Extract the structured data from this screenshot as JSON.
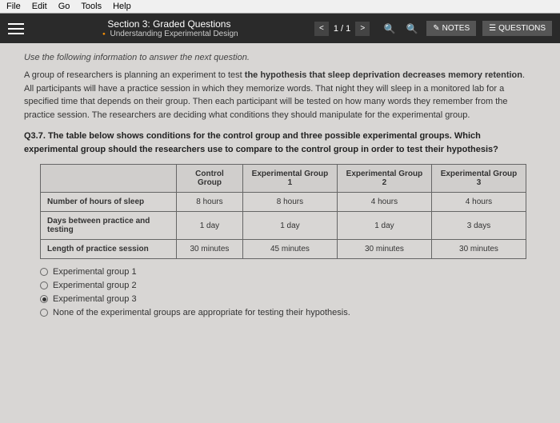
{
  "menu": {
    "file": "File",
    "edit": "Edit",
    "go": "Go",
    "tools": "Tools",
    "help": "Help"
  },
  "header": {
    "section": "Section 3: Graded Questions",
    "subtitle": "Understanding Experimental Design",
    "page": "1 / 1",
    "notes": "NOTES",
    "questions": "QUESTIONS"
  },
  "instruction": "Use the following information to answer the next question.",
  "paragraph_pre": "A group of researchers is planning an experiment to test ",
  "paragraph_bold": "the hypothesis that sleep deprivation decreases memory retention",
  "paragraph_post": ". All participants will have a practice session in which they memorize words. That night they will sleep in a monitored lab for a specified time that depends on their group. Then each participant will be tested on how many words they remember from the practice session. The researchers are deciding what conditions they should manipulate for the experimental group.",
  "question": "Q3.7. The table below shows conditions for the control group and three possible experimental groups. Which experimental group should the researchers use to compare to the control group in order to test their hypothesis?",
  "table": {
    "headers": [
      "",
      "Control Group",
      "Experimental Group 1",
      "Experimental Group 2",
      "Experimental Group 3"
    ],
    "rows": [
      [
        "Number of hours of sleep",
        "8 hours",
        "8 hours",
        "4 hours",
        "4 hours"
      ],
      [
        "Days between practice and testing",
        "1 day",
        "1 day",
        "1 day",
        "3 days"
      ],
      [
        "Length of practice session",
        "30 minutes",
        "45 minutes",
        "30 minutes",
        "30 minutes"
      ]
    ]
  },
  "options": {
    "a": "Experimental group 1",
    "b": "Experimental group 2",
    "c": "Experimental group 3",
    "d": "None of the experimental groups are appropriate for testing their hypothesis."
  }
}
